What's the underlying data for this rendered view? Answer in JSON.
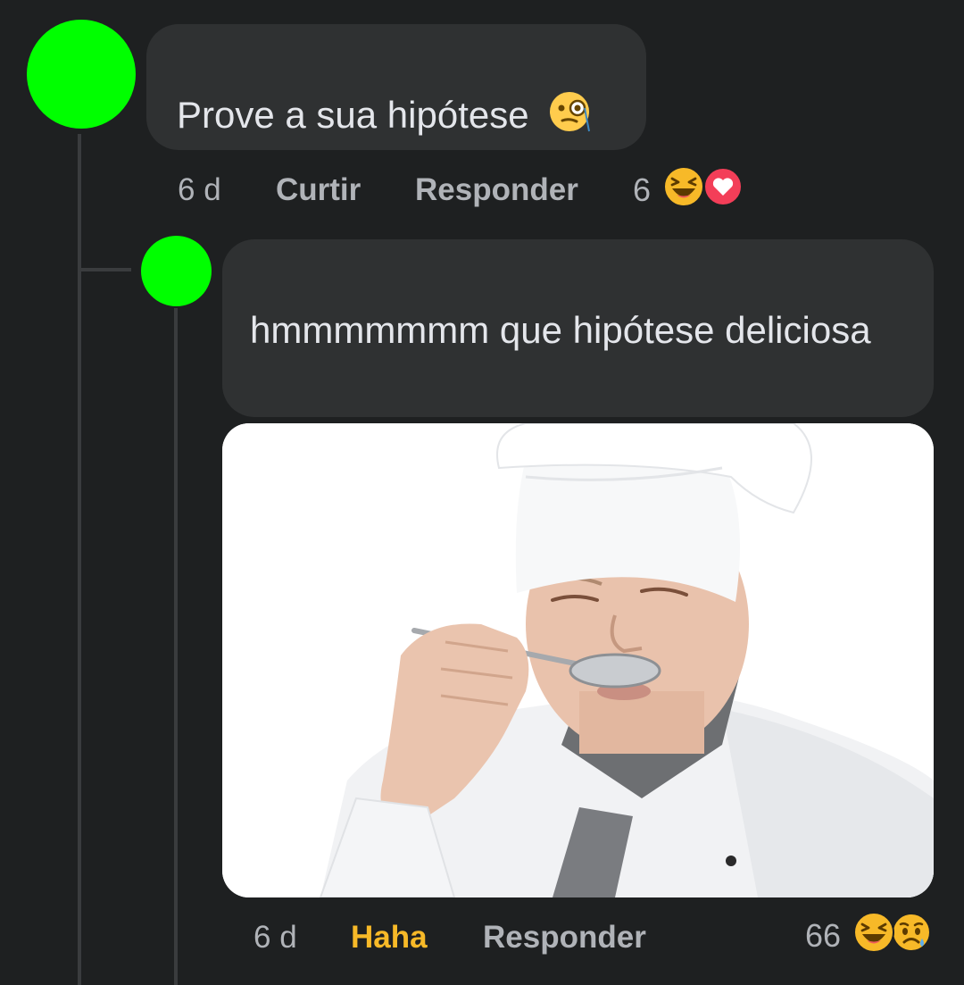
{
  "comments": [
    {
      "text": "Prove a sua hipótese",
      "emoji": "monocle-face",
      "time": "6 d",
      "like_label": "Curtir",
      "reply_label": "Responder",
      "reaction_count": "6",
      "reactions": [
        "haha",
        "love"
      ]
    },
    {
      "text": "hmmmmmmm que hipótese deliciosa",
      "attachment": "chef-tasting-spoon-photo",
      "time": "6 d",
      "like_label": "Haha",
      "reply_label": "Responder",
      "reaction_count": "66",
      "reactions": [
        "haha",
        "sad"
      ]
    }
  ],
  "colors": {
    "background": "#1e2021",
    "bubble": "#2f3132",
    "avatar": "#00ff00",
    "haha_active": "#f7b928",
    "love": "#f33e58"
  }
}
